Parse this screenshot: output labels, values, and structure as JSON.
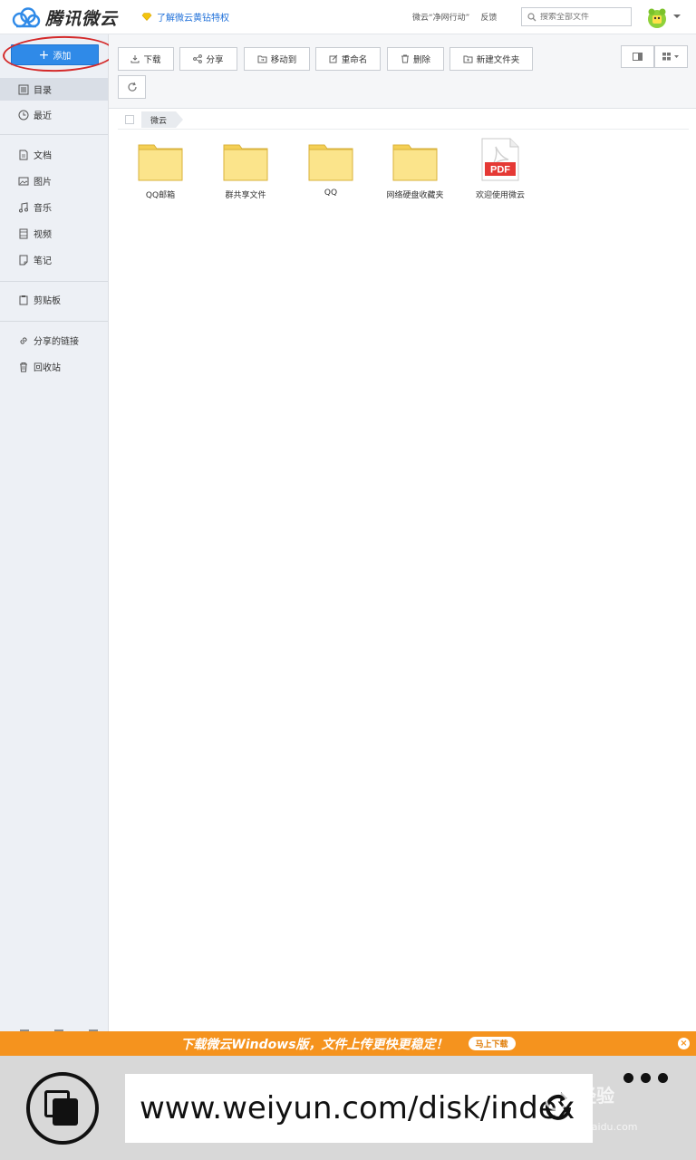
{
  "header": {
    "logo_text": "腾讯微云",
    "vip_link": "了解微云黄钻特权",
    "links": [
      "微云“净网行动”",
      "反馈"
    ],
    "search_placeholder": "搜索全部文件"
  },
  "sidebar": {
    "add_label": "添加",
    "items": [
      {
        "label": "目录",
        "icon": "list-icon",
        "active": true
      },
      {
        "label": "最近",
        "icon": "clock-icon"
      },
      {
        "label": "文档",
        "icon": "document-icon"
      },
      {
        "label": "图片",
        "icon": "image-icon"
      },
      {
        "label": "音乐",
        "icon": "music-icon"
      },
      {
        "label": "视频",
        "icon": "video-icon"
      },
      {
        "label": "笔记",
        "icon": "note-icon"
      },
      {
        "label": "剪贴板",
        "icon": "clipboard-icon"
      },
      {
        "label": "分享的链接",
        "icon": "link-icon"
      },
      {
        "label": "回收站",
        "icon": "trash-icon"
      }
    ]
  },
  "toolbar": {
    "download": "下载",
    "share": "分享",
    "move_to": "移动到",
    "rename": "重命名",
    "delete": "删除",
    "new_folder": "新建文件夹"
  },
  "breadcrumb": {
    "root": "微云"
  },
  "files": [
    {
      "name": "QQ邮箱",
      "type": "folder"
    },
    {
      "name": "群共享文件",
      "type": "folder"
    },
    {
      "name": "QQ",
      "type": "folder"
    },
    {
      "name": "网络硬盘收藏夹",
      "type": "folder"
    },
    {
      "name": "欢迎使用微云",
      "type": "pdf",
      "badge": "PDF"
    }
  ],
  "banner": {
    "text": "下载微云Windows版，文件上传更快更稳定！",
    "button": "马上下载",
    "close": "×"
  },
  "browser": {
    "url": "www.weiyun.com/disk/index",
    "watermark": "经验",
    "watermark_sub": "jingyan.baidu.com"
  },
  "colors": {
    "accent": "#2f8ae8",
    "banner": "#f5931e",
    "annotation": "#d42a2a",
    "folder": "#f9d960"
  }
}
